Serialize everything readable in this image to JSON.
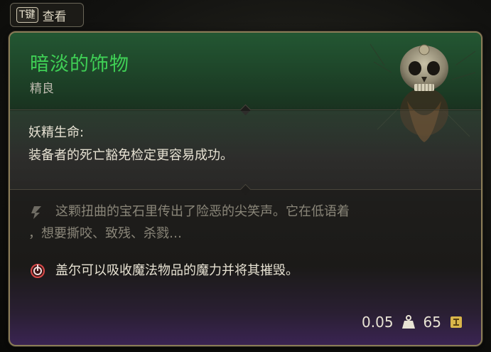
{
  "key_hint": {
    "key": "T键",
    "label": "查看"
  },
  "item": {
    "name": "暗淡的饰物",
    "rarity": "精良",
    "name_color": "#3fcf55"
  },
  "effect": {
    "title": "妖精生命:",
    "description": "装备者的死亡豁免检定更容易成功。"
  },
  "flavor": {
    "icon": "quill-icon",
    "line1": "这颗扭曲的宝石里传出了险恶的尖笑声。它在低语着",
    "line2": "，想要撕咬、致残、杀戮…"
  },
  "note": {
    "icon": "gale-absorb-icon",
    "text": "盖尔可以吸收魔法物品的魔力并将其摧毁。"
  },
  "footer": {
    "weight": "0.05",
    "weight_icon": "weight-icon",
    "value": "65",
    "value_icon": "gold-coin-icon"
  }
}
